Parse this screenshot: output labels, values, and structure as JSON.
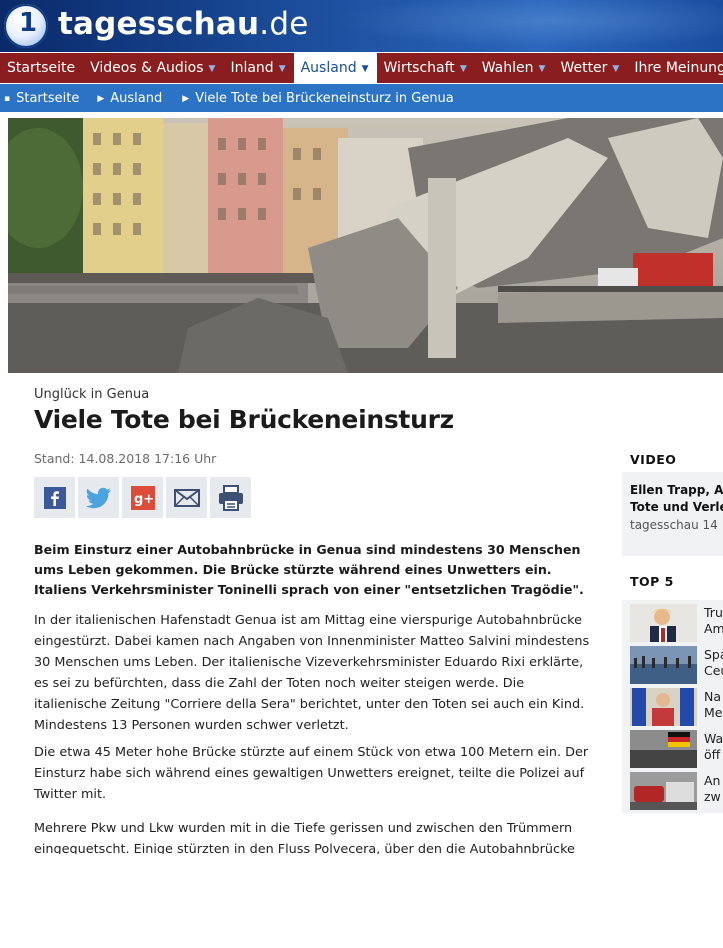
{
  "header": {
    "logo_symbol": "1",
    "brand_main": "tagesschau",
    "brand_domain": ".de"
  },
  "nav": [
    {
      "label": "Startseite",
      "has_caret": false,
      "active": false
    },
    {
      "label": "Videos & Audios",
      "has_caret": true,
      "active": false
    },
    {
      "label": "Inland",
      "has_caret": true,
      "active": false
    },
    {
      "label": "Ausland",
      "has_caret": true,
      "active": true
    },
    {
      "label": "Wirtschaft",
      "has_caret": true,
      "active": false
    },
    {
      "label": "Wahlen",
      "has_caret": true,
      "active": false
    },
    {
      "label": "Wetter",
      "has_caret": true,
      "active": false
    },
    {
      "label": "Ihre Meinung",
      "has_caret": true,
      "active": false
    }
  ],
  "breadcrumb": [
    "Startseite",
    "Ausland",
    "Viele Tote bei Brückeneinsturz in Genua"
  ],
  "article": {
    "kicker": "Unglück in Genua",
    "title": "Viele Tote bei Brückeneinsturz",
    "stand": "Stand: 14.08.2018 17:16 Uhr",
    "share_icons": [
      "facebook-icon",
      "twitter-icon",
      "googleplus-icon",
      "mail-icon",
      "print-icon"
    ],
    "lead": "Beim Einsturz einer Autobahnbrücke in Genua sind mindestens 30 Menschen ums Leben gekommen. Die Brücke stürzte während eines Unwetters ein. Italiens Verkehrsminister Toninelli sprach von einer \"entsetzlichen Tragödie\".",
    "p1": "In der italienischen Hafenstadt Genua ist am Mittag eine vierspurige Autobahnbrücke eingestürzt. Dabei kamen nach Angaben von Innenminister Matteo Salvini mindestens 30 Menschen ums Leben. Der italienische Vizeverkehrsminister Eduardo Rixi erklärte, es sei zu befürchten, dass die Zahl der Toten noch weiter steigen werde. Die italienische Zeitung \"Corriere della Sera\" berichtet, unter den Toten sei auch ein Kind. Mindestens 13 Personen wurden schwer verletzt.",
    "p2": "Die etwa 45 Meter hohe Brücke stürzte auf einem Stück von etwa 100 Metern ein. Der Einsturz habe sich während eines gewaltigen Unwetters ereignet, teilte die Polizei auf Twitter mit.",
    "p3": "Mehrere Pkw und Lkw wurden mit in die Tiefe gerissen und zwischen den Trümmern eingequetscht. Einige stürzten in den Fluss Polvecera, über den die Autobahnbrücke"
  },
  "sidebar": {
    "video_heading": "VIDEO",
    "video_title_line1": "Ellen Trapp, AR",
    "video_title_line2": "Tote und Verle",
    "video_meta": "tagesschau 14",
    "top5_heading": "TOP 5",
    "top5": [
      {
        "line1": "Tru",
        "line2": "Am"
      },
      {
        "line1": "Spa",
        "line2": "Ceu"
      },
      {
        "line1": "Na",
        "line2": "Me"
      },
      {
        "line1": "Wa",
        "line2": "öff"
      },
      {
        "line1": "An",
        "line2": "zw"
      }
    ]
  },
  "colors": {
    "nav_bg": "#8a1d1d",
    "breadcrumb_bg": "#2b73c4",
    "brand_blue": "#1b4c9a",
    "caret_blue": "#8fb4ec"
  }
}
